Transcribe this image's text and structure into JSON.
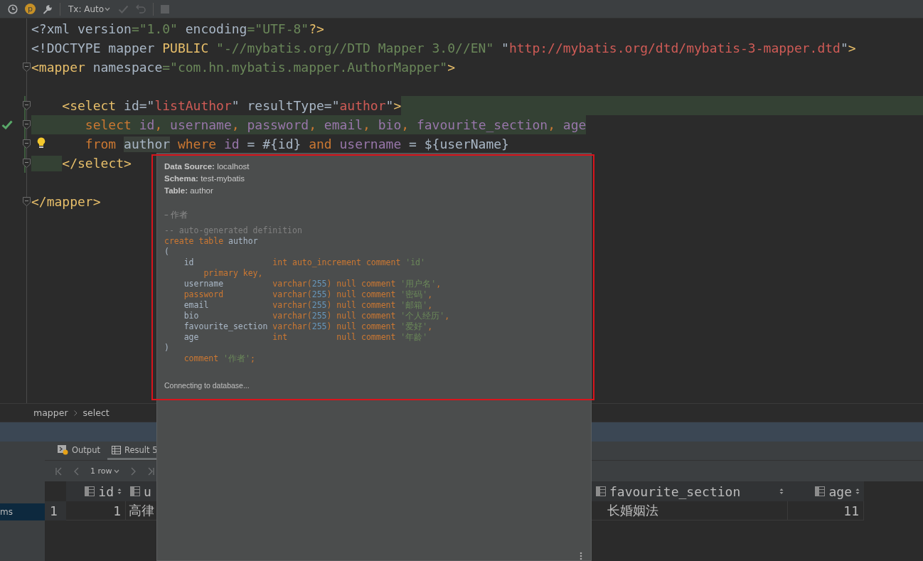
{
  "toolbar": {
    "items": [
      {
        "kind": "history"
      },
      {
        "kind": "badge",
        "label": "p"
      },
      {
        "kind": "settings"
      },
      {
        "kind": "separator"
      },
      {
        "kind": "dropdown",
        "label": "Tx: Auto"
      },
      {
        "kind": "commit",
        "disabled": true
      },
      {
        "kind": "rollback",
        "disabled": true
      },
      {
        "kind": "separator"
      },
      {
        "kind": "stop",
        "disabled": true
      }
    ]
  },
  "editor": {
    "lines": [
      {
        "kind": "code",
        "fold": false,
        "tokens": [
          {
            "text": "<?xml version",
            "kind": "plain"
          },
          {
            "text": "=\"1.0\"",
            "kind": "string"
          },
          {
            "text": " encoding",
            "kind": "plain"
          },
          {
            "text": "=\"UTF-8\"",
            "kind": "string"
          },
          {
            "text": "?>",
            "kind": "tag"
          }
        ]
      },
      {
        "kind": "code",
        "fold": false,
        "tokens": [
          {
            "text": "<!DOCTYPE mapper ",
            "kind": "plain"
          },
          {
            "text": "PUBLIC",
            "kind": "tag"
          },
          {
            "text": " \"-//mybatis.org//DTD Mapper 3.0//EN\"",
            "kind": "string"
          },
          {
            "text": " \"",
            "kind": "plain"
          },
          {
            "text": "http://mybatis.org/dtd/mybatis-3-mapper.dtd",
            "kind": "url"
          },
          {
            "text": "\"",
            "kind": "plain"
          },
          {
            "text": ">",
            "kind": "tag"
          }
        ]
      },
      {
        "kind": "code",
        "fold": true,
        "tokens": [
          {
            "text": "<mapper",
            "kind": "tag"
          },
          {
            "text": " namespace",
            "kind": "plain"
          },
          {
            "text": "=\"com.hn.mybatis.mapper.AuthorMapper\"",
            "kind": "string"
          },
          {
            "text": ">",
            "kind": "tag"
          }
        ]
      },
      {
        "kind": "blank"
      },
      {
        "kind": "code",
        "fold": true,
        "changed": true,
        "shade_tail": true,
        "tokens": [
          {
            "text": "    <select",
            "kind": "tag"
          },
          {
            "text": " id=\"",
            "kind": "plain"
          },
          {
            "text": "listAuthor",
            "kind": "url"
          },
          {
            "text": "\" resultType=\"",
            "kind": "plain"
          },
          {
            "text": "author",
            "kind": "url"
          },
          {
            "text": "\"",
            "kind": "plain"
          },
          {
            "text": ">",
            "kind": "tag"
          }
        ]
      },
      {
        "kind": "code",
        "fold": true,
        "changed": true,
        "shaded": true,
        "gutter": {
          "kind": "check"
        },
        "tokens": [
          {
            "text": "       select",
            "kind": "keyword"
          },
          {
            "text": " id",
            "kind": "ident"
          },
          {
            "text": ",",
            "kind": "keyword"
          },
          {
            "text": " username",
            "kind": "ident"
          },
          {
            "text": ",",
            "kind": "keyword"
          },
          {
            "text": " password",
            "kind": "ident"
          },
          {
            "text": ",",
            "kind": "keyword"
          },
          {
            "text": " email",
            "kind": "ident"
          },
          {
            "text": ",",
            "kind": "keyword"
          },
          {
            "text": " bio",
            "kind": "ident"
          },
          {
            "text": ",",
            "kind": "keyword"
          },
          {
            "text": " favourite_section",
            "kind": "ident"
          },
          {
            "text": ",",
            "kind": "keyword"
          },
          {
            "text": " age",
            "kind": "ident"
          }
        ]
      },
      {
        "kind": "code",
        "fold": true,
        "changed": true,
        "gutter": {
          "kind": "bulb"
        },
        "tokens": [
          {
            "text": "       from ",
            "kind": "keyword"
          },
          {
            "text": "author",
            "kind": "plain",
            "shaded": true
          },
          {
            "text": " where",
            "kind": "keyword"
          },
          {
            "text": " id",
            "kind": "ident"
          },
          {
            "text": " = #{id} ",
            "kind": "plain"
          },
          {
            "text": "and",
            "kind": "keyword"
          },
          {
            "text": " username",
            "kind": "ident"
          },
          {
            "text": " = ${userName}",
            "kind": "plain"
          }
        ]
      },
      {
        "kind": "code",
        "fold": true,
        "changed": true,
        "shade_indent": true,
        "tokens": [
          {
            "text": "    </select>",
            "kind": "tag"
          }
        ]
      },
      {
        "kind": "blank"
      },
      {
        "kind": "code",
        "fold": true,
        "tokens": [
          {
            "text": "</mapper>",
            "kind": "tag"
          }
        ]
      }
    ]
  },
  "breadcrumbs": [
    "mapper",
    "select"
  ],
  "tool_window": {
    "sidebar_items": [
      {
        "label": "ms",
        "selected": true
      }
    ],
    "tabs": [
      {
        "label": "Output",
        "kind": "output",
        "selected": false
      },
      {
        "label": "Result 5",
        "kind": "table",
        "selected": true
      }
    ],
    "pager": "1 row",
    "table": {
      "columns": [
        {
          "label": "id",
          "kind": "number",
          "sort_icon": true
        },
        {
          "label": "u",
          "kind": "text",
          "sort_icon": false
        },
        {
          "label": "favourite_section",
          "kind": "text",
          "sort_icon": true
        },
        {
          "label": "age",
          "kind": "number",
          "sort_icon": true
        }
      ],
      "rows": [
        {
          "number": "1",
          "cells": [
            "1",
            "高律",
            "长婚姻法",
            "11"
          ]
        }
      ]
    }
  },
  "popup": {
    "info": [
      "**Data Source:** localhost",
      "**Schema:** test-mybatis",
      "**Table:** author"
    ],
    "table_comment": "– 作者",
    "ddl": [
      [
        {
          "text": "-- auto-generated definition",
          "kind": "comment"
        }
      ],
      [
        {
          "text": "create table",
          "kind": "keyword"
        },
        {
          "text": " author",
          "kind": "plain"
        }
      ],
      [
        {
          "text": "(",
          "kind": "plain"
        }
      ],
      [
        {
          "text": "    id                ",
          "kind": "plain"
        },
        {
          "text": "int auto_increment comment",
          "kind": "keyword"
        },
        {
          "text": " 'id'",
          "kind": "string"
        }
      ],
      [
        {
          "text": "        primary key,",
          "kind": "keyword"
        }
      ],
      [
        {
          "text": "    username          ",
          "kind": "plain"
        },
        {
          "text": "varchar(",
          "kind": "keyword"
        },
        {
          "text": "255",
          "kind": "number"
        },
        {
          "text": ") null comment",
          "kind": "keyword"
        },
        {
          "text": " '用户名'",
          "kind": "string"
        },
        {
          "text": ",",
          "kind": "keyword"
        }
      ],
      [
        {
          "text": "    password          varchar(",
          "kind": "keyword"
        },
        {
          "text": "255",
          "kind": "number"
        },
        {
          "text": ") null comment",
          "kind": "keyword"
        },
        {
          "text": " '密码'",
          "kind": "string"
        },
        {
          "text": ",",
          "kind": "keyword"
        }
      ],
      [
        {
          "text": "    email             ",
          "kind": "plain"
        },
        {
          "text": "varchar(",
          "kind": "keyword"
        },
        {
          "text": "255",
          "kind": "number"
        },
        {
          "text": ") null comment",
          "kind": "keyword"
        },
        {
          "text": " '邮箱'",
          "kind": "string"
        },
        {
          "text": ",",
          "kind": "keyword"
        }
      ],
      [
        {
          "text": "    bio               ",
          "kind": "plain"
        },
        {
          "text": "varchar(",
          "kind": "keyword"
        },
        {
          "text": "255",
          "kind": "number"
        },
        {
          "text": ") null comment",
          "kind": "keyword"
        },
        {
          "text": " '个人经历'",
          "kind": "string"
        },
        {
          "text": ",",
          "kind": "keyword"
        }
      ],
      [
        {
          "text": "    favourite_section ",
          "kind": "plain"
        },
        {
          "text": "varchar(",
          "kind": "keyword"
        },
        {
          "text": "255",
          "kind": "number"
        },
        {
          "text": ") null comment",
          "kind": "keyword"
        },
        {
          "text": " '爱好'",
          "kind": "string"
        },
        {
          "text": ",",
          "kind": "keyword"
        }
      ],
      [
        {
          "text": "    age               ",
          "kind": "plain"
        },
        {
          "text": "int          null comment",
          "kind": "keyword"
        },
        {
          "text": " '年龄'",
          "kind": "string"
        }
      ],
      [
        {
          "text": ")",
          "kind": "plain"
        }
      ],
      [
        {
          "text": "    comment",
          "kind": "keyword"
        },
        {
          "text": " '作者'",
          "kind": "string"
        },
        {
          "text": ";",
          "kind": "keyword"
        }
      ]
    ],
    "status": "Connecting to database..."
  }
}
